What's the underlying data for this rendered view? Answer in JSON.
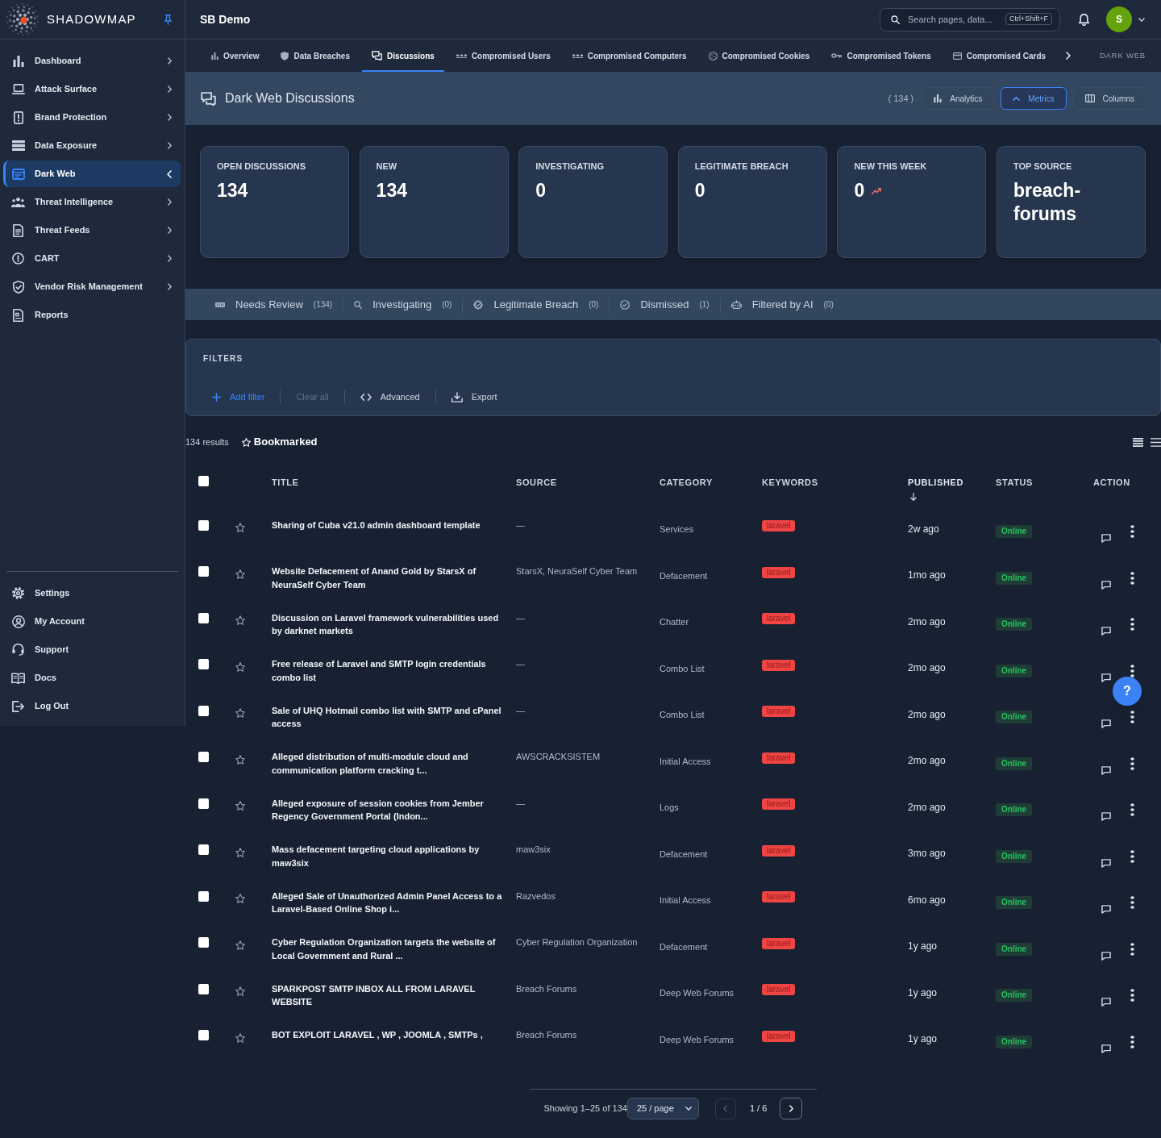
{
  "sidebar": {
    "logo": "SHADOWMAP",
    "items": [
      {
        "label": "Dashboard",
        "selected": false,
        "expanded": false
      },
      {
        "label": "Attack Surface",
        "selected": false,
        "expanded": false
      },
      {
        "label": "Brand Protection",
        "selected": false,
        "expanded": false
      },
      {
        "label": "Data Exposure",
        "selected": false,
        "expanded": false
      },
      {
        "label": "Dark Web",
        "selected": true,
        "expanded": true
      },
      {
        "label": "Threat Intelligence",
        "selected": false,
        "expanded": false
      },
      {
        "label": "Threat Feeds",
        "selected": false,
        "expanded": false
      },
      {
        "label": "CART",
        "selected": false,
        "expanded": false
      },
      {
        "label": "Vendor Risk Management",
        "selected": false,
        "expanded": false
      },
      {
        "label": "Reports",
        "selected": false
      }
    ],
    "bottom_items": [
      {
        "label": "Settings",
        "selected": false
      },
      {
        "label": "My Account",
        "selected": false
      },
      {
        "label": "Support",
        "selected": false
      },
      {
        "label": "Docs",
        "selected": false
      },
      {
        "label": "Log Out",
        "selected": false
      }
    ]
  },
  "header": {
    "title": "SB Demo",
    "search": {
      "placeholder": "Search pages, data...",
      "shortcut": "Ctrl+Shift+F"
    },
    "avatar": "S"
  },
  "tabs": [
    {
      "label": "Overview",
      "selected": false
    },
    {
      "label": "Data Breaches",
      "selected": false
    },
    {
      "label": "Discussions",
      "selected": true
    },
    {
      "label": "Compromised Users",
      "selected": false
    },
    {
      "label": "Compromised Computers",
      "selected": false
    },
    {
      "label": "Compromised Cookies",
      "selected": false
    },
    {
      "label": "Compromised Tokens",
      "selected": false
    },
    {
      "label": "Compromised Cards",
      "selected": false
    }
  ],
  "section_label": "DARK WEB",
  "page_header": {
    "title": "Dark Web Discussions",
    "count": "( 134 )",
    "buttons": [
      {
        "label": "Analytics",
        "selected": false
      },
      {
        "label": "Metrics",
        "selected": true
      },
      {
        "label": "Columns",
        "selected": false
      }
    ]
  },
  "metrics": [
    {
      "label": "OPEN DISCUSSIONS",
      "value": "134",
      "trend_up": false
    },
    {
      "label": "NEW",
      "value": "134",
      "trend_up": false
    },
    {
      "label": "INVESTIGATING",
      "value": "0",
      "trend_up": false
    },
    {
      "label": "LEGITIMATE BREACH",
      "value": "0",
      "trend_up": false
    },
    {
      "label": "NEW THIS WEEK",
      "value": "0",
      "trend_up": true
    },
    {
      "label": "TOP SOURCE",
      "value": "breach-forums",
      "trend_up": false
    }
  ],
  "status_tabs": [
    {
      "label": "Needs Review",
      "count": "(134)",
      "selected": false
    },
    {
      "label": "Investigating",
      "count": "(0)",
      "selected": false
    },
    {
      "label": "Legitimate Breach",
      "count": "(0)",
      "selected": false
    },
    {
      "label": "Dismissed",
      "count": "(1)",
      "selected": false
    },
    {
      "label": "Filtered by AI",
      "count": "(0)",
      "selected": false
    }
  ],
  "filters": {
    "title": "FILTERS",
    "actions": [
      {
        "label": "Add filter",
        "kind": "primary",
        "disabled": false
      },
      {
        "label": "Clear all",
        "kind": "plain",
        "disabled": true
      },
      {
        "label": "Advanced",
        "kind": "plain",
        "disabled": false
      },
      {
        "label": "Export",
        "kind": "plain",
        "disabled": false
      }
    ]
  },
  "results": {
    "count": "134 results",
    "bookmarked": {
      "label": "Bookmarked",
      "selected": false
    }
  },
  "table": {
    "select_all": {
      "checked": false
    },
    "columns": [
      {
        "label": "TITLE",
        "sorted": false
      },
      {
        "label": "SOURCE",
        "sorted": false
      },
      {
        "label": "CATEGORY",
        "sorted": false
      },
      {
        "label": "KEYWORDS",
        "sorted": false
      },
      {
        "label": "PUBLISHED",
        "sorted": true
      },
      {
        "label": "STATUS",
        "sorted": false
      },
      {
        "label": "ACTION",
        "sorted": false
      }
    ],
    "rows": [
      {
        "checked": false,
        "bookmarked": false,
        "title": "Sharing of Cuba v21.0 admin dashboard template",
        "source": "—",
        "category": "Services",
        "keywords": [
          "laravel"
        ],
        "published": "2w ago",
        "status": "Online"
      },
      {
        "checked": false,
        "bookmarked": false,
        "title": "Website Defacement of Anand Gold by StarsX of NeuraSelf Cyber Team",
        "source": "StarsX, NeuraSelf Cyber Team",
        "category": "Defacement",
        "keywords": [
          "laravel"
        ],
        "published": "1mo ago",
        "status": "Online"
      },
      {
        "checked": false,
        "bookmarked": false,
        "title": "Discussion on Laravel framework vulnerabilities used by darknet markets",
        "source": "—",
        "category": "Chatter",
        "keywords": [
          "laravel"
        ],
        "published": "2mo ago",
        "status": "Online"
      },
      {
        "checked": false,
        "bookmarked": false,
        "title": "Free release of Laravel and SMTP login credentials combo list",
        "source": "—",
        "category": "Combo List",
        "keywords": [
          "laravel"
        ],
        "published": "2mo ago",
        "status": "Online"
      },
      {
        "checked": false,
        "bookmarked": false,
        "title": "Sale of UHQ Hotmail combo list with SMTP and cPanel access",
        "source": "—",
        "category": "Combo List",
        "keywords": [
          "laravel"
        ],
        "published": "2mo ago",
        "status": "Online"
      },
      {
        "checked": false,
        "bookmarked": false,
        "title": "Alleged distribution of multi-module cloud and communication platform cracking t...",
        "source": "AWSCRACKSISTEM",
        "category": "Initial Access",
        "keywords": [
          "laravel"
        ],
        "published": "2mo ago",
        "status": "Online"
      },
      {
        "checked": false,
        "bookmarked": false,
        "title": "Alleged exposure of session cookies from Jember Regency Government Portal (Indon...",
        "source": "—",
        "category": "Logs",
        "keywords": [
          "laravel"
        ],
        "published": "2mo ago",
        "status": "Online"
      },
      {
        "checked": false,
        "bookmarked": false,
        "title": "Mass defacement targeting cloud applications by maw3six",
        "source": "maw3six",
        "category": "Defacement",
        "keywords": [
          "laravel"
        ],
        "published": "3mo ago",
        "status": "Online"
      },
      {
        "checked": false,
        "bookmarked": false,
        "title": "Alleged Sale of Unauthorized Admin Panel Access to a Laravel-Based Online Shop i...",
        "source": "Razvedos",
        "category": "Initial Access",
        "keywords": [
          "laravel"
        ],
        "published": "6mo ago",
        "status": "Online"
      },
      {
        "checked": false,
        "bookmarked": false,
        "title": "Cyber Regulation Organization targets the website of Local Government and Rural ...",
        "source": "Cyber Regulation Organization",
        "category": "Defacement",
        "keywords": [
          "laravel"
        ],
        "published": "1y ago",
        "status": "Online"
      },
      {
        "checked": false,
        "bookmarked": false,
        "title": "SPARKPOST SMTP INBOX ALL FROM LARAVEL WEBSITE",
        "source": "Breach Forums",
        "category": "Deep Web Forums",
        "keywords": [
          "laravel"
        ],
        "published": "1y ago",
        "status": "Online"
      },
      {
        "checked": false,
        "bookmarked": false,
        "title": "BOT EXPLOIT LARAVEL , WP , JOOMLA , SMTPs ,",
        "source": "Breach Forums",
        "category": "Deep Web Forums",
        "keywords": [
          "laravel"
        ],
        "published": "1y ago",
        "status": "Online"
      }
    ]
  },
  "pagination": {
    "summary": "Showing 1–25 of 134",
    "page_size": "25 / page",
    "page": "1 / 6",
    "prev_disabled": true,
    "next_disabled": false
  },
  "help_button": {
    "label": "?"
  }
}
